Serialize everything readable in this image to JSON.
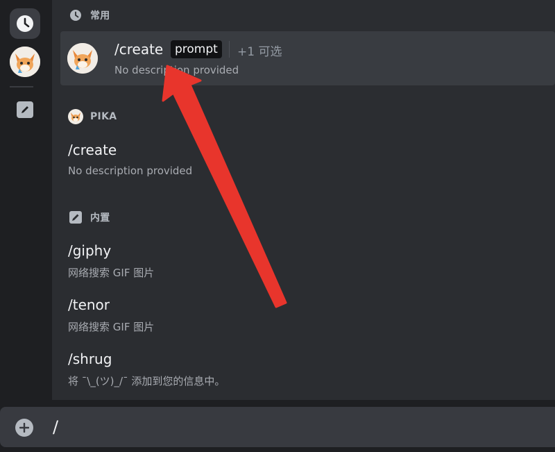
{
  "sections": {
    "frequent": {
      "title": "常用",
      "icon": "clock-icon"
    },
    "pika": {
      "title": "PIKA",
      "icon": "pika-avatar-icon"
    },
    "builtin": {
      "title": "内置",
      "icon": "pencil-icon"
    }
  },
  "selected_command": {
    "name": "/create",
    "option_chip": "prompt",
    "optional_label": "+1 可选",
    "description": "No description provided"
  },
  "pika_commands": [
    {
      "name": "/create",
      "description": "No description provided"
    }
  ],
  "builtin_commands": [
    {
      "name": "/giphy",
      "description": "网络搜索 GIF 图片"
    },
    {
      "name": "/tenor",
      "description": "网络搜索 GIF 图片"
    },
    {
      "name": "/shrug",
      "description": "将 ¯\\_(ツ)_/¯ 添加到您的信息中。"
    }
  ],
  "composer": {
    "value": "/",
    "icon": "add-circle-icon"
  },
  "colors": {
    "background": "#2b2d31",
    "rail": "#1e1f22",
    "selected_row": "#393c41",
    "annotation_arrow": "#e8352c"
  }
}
